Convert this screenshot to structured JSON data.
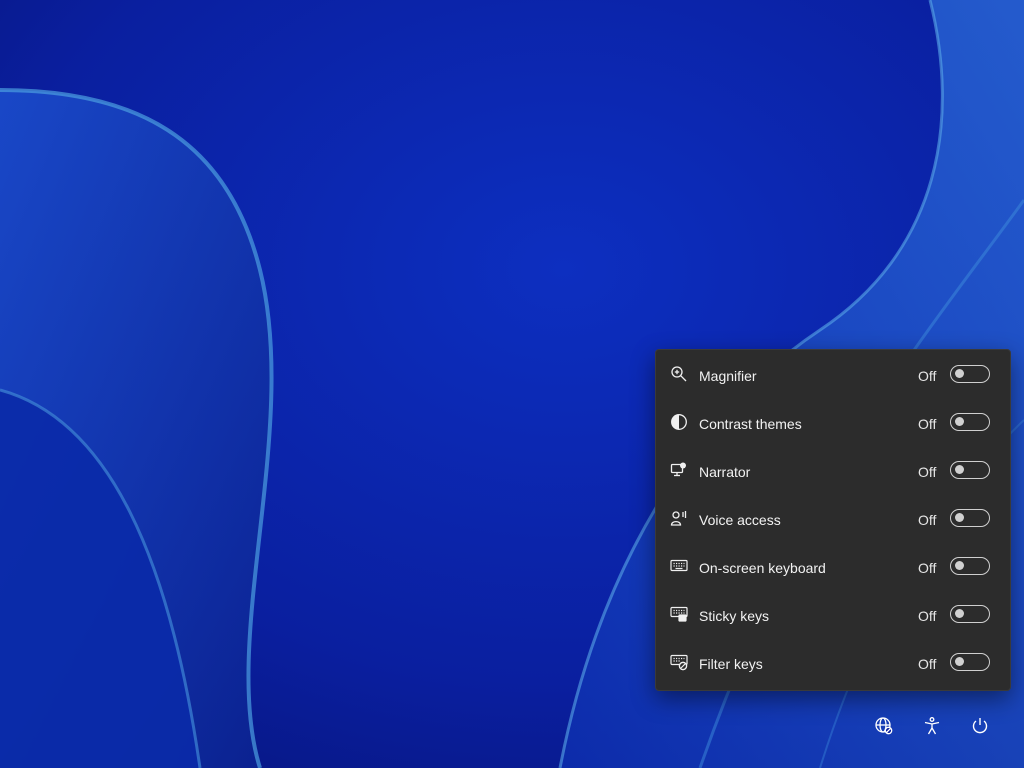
{
  "theme": {
    "accent": "#0a1e9e",
    "panel_bg": "#2c2c2c",
    "text": "#f2f2f2"
  },
  "accessibility_panel": {
    "items": [
      {
        "icon": "magnifier-icon",
        "label": "Magnifier",
        "state": "Off",
        "on": false
      },
      {
        "icon": "contrast-icon",
        "label": "Contrast themes",
        "state": "Off",
        "on": false
      },
      {
        "icon": "narrator-icon",
        "label": "Narrator",
        "state": "Off",
        "on": false
      },
      {
        "icon": "voice-access-icon",
        "label": "Voice access",
        "state": "Off",
        "on": false
      },
      {
        "icon": "keyboard-icon",
        "label": "On-screen keyboard",
        "state": "Off",
        "on": false
      },
      {
        "icon": "sticky-keys-icon",
        "label": "Sticky keys",
        "state": "Off",
        "on": false
      },
      {
        "icon": "filter-keys-icon",
        "label": "Filter keys",
        "state": "Off",
        "on": false
      }
    ]
  },
  "tray": {
    "buttons": [
      {
        "icon": "network-icon"
      },
      {
        "icon": "accessibility-icon"
      },
      {
        "icon": "power-icon"
      }
    ]
  }
}
